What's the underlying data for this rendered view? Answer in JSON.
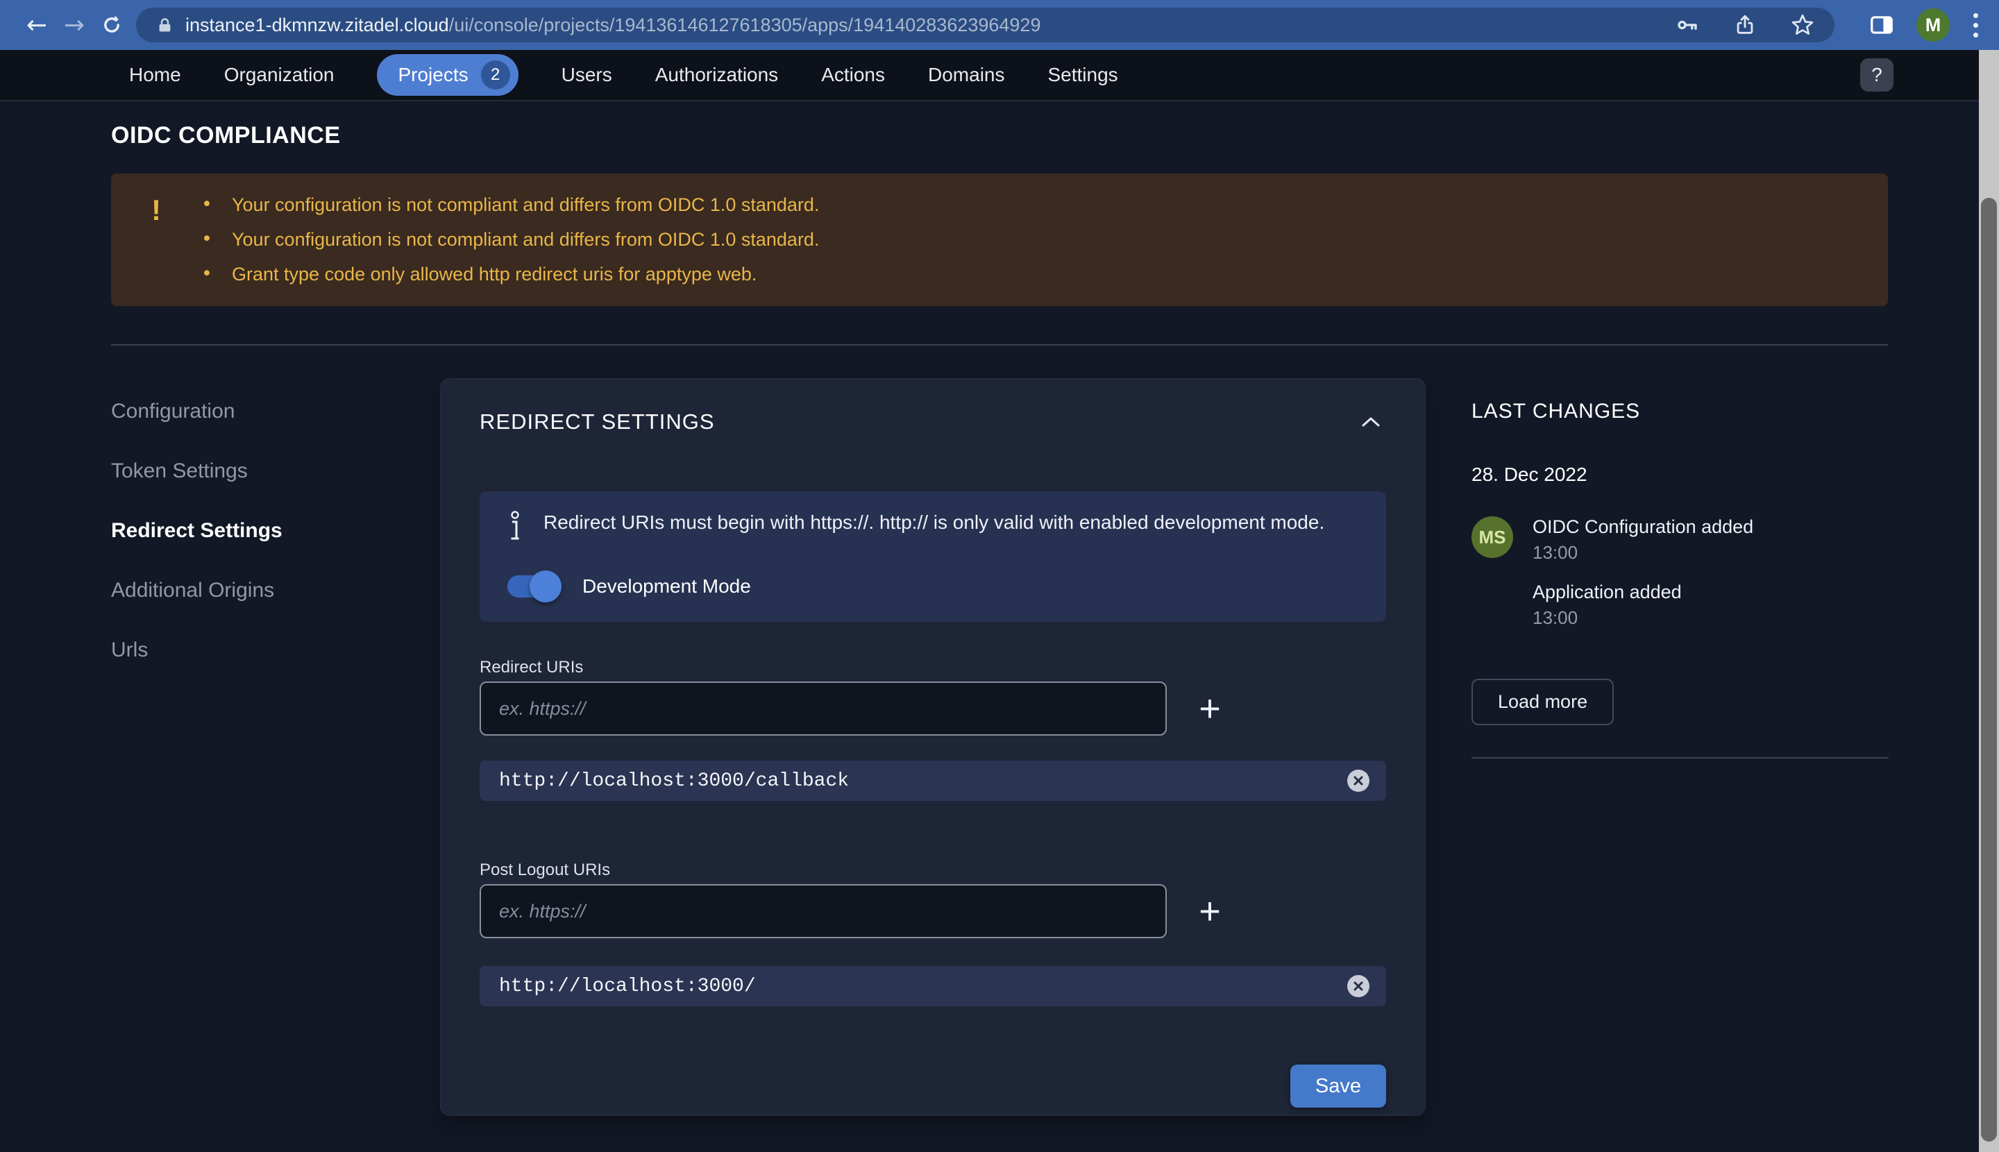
{
  "browser": {
    "url": {
      "host": "instance1-dkmnzw.zitadel.cloud",
      "path": "/ui/console/projects/194136146127618305/apps/194140283623964929"
    },
    "avatar_initial": "M",
    "icons": {
      "back": "←",
      "forward": "→"
    }
  },
  "nav": {
    "items": [
      "Home",
      "Organization",
      "Projects",
      "Users",
      "Authorizations",
      "Actions",
      "Domains",
      "Settings"
    ],
    "active_item": "Projects",
    "projects_badge": "2",
    "help_label": "?"
  },
  "page": {
    "title": "OIDC COMPLIANCE",
    "warning_icon": "!",
    "bullet": "•",
    "warnings": [
      "Your configuration is not compliant and differs from OIDC 1.0 standard.",
      "Your configuration is not compliant and differs from OIDC 1.0 standard.",
      "Grant type code only allowed http redirect uris for apptype web."
    ]
  },
  "sidebar": {
    "items": [
      "Configuration",
      "Token Settings",
      "Redirect Settings",
      "Additional Origins",
      "Urls"
    ],
    "active_item": "Redirect Settings"
  },
  "card": {
    "title": "REDIRECT SETTINGS",
    "info_text": "Redirect URIs must begin with https://. http:// is only valid with enabled development mode.",
    "dev_mode_label": "Development Mode",
    "dev_mode_enabled": true,
    "redirect_uris": {
      "label": "Redirect URIs",
      "placeholder": "ex. https://",
      "add_icon": "+",
      "items": [
        "http://localhost:3000/callback"
      ]
    },
    "post_logout_uris": {
      "label": "Post Logout URIs",
      "placeholder": "ex. https://",
      "add_icon": "+",
      "items": [
        "http://localhost:3000/"
      ]
    },
    "save_label": "Save"
  },
  "last_changes": {
    "title": "LAST CHANGES",
    "date": "28. Dec 2022",
    "avatar_initials": "MS",
    "events": [
      {
        "title": "OIDC Configuration added",
        "time": "13:00"
      },
      {
        "title": "Application added",
        "time": "13:00"
      }
    ],
    "load_more_label": "Load more"
  },
  "colors": {
    "toolbar_blue": "#3a65aa",
    "accent_blue": "#4e7ed2",
    "save_blue": "#4579ca",
    "warning_bg": "#3a2a1f",
    "warning_text": "#e9b64a",
    "card_bg": "#1e2537",
    "avatar_green": "#4d7a2e"
  }
}
